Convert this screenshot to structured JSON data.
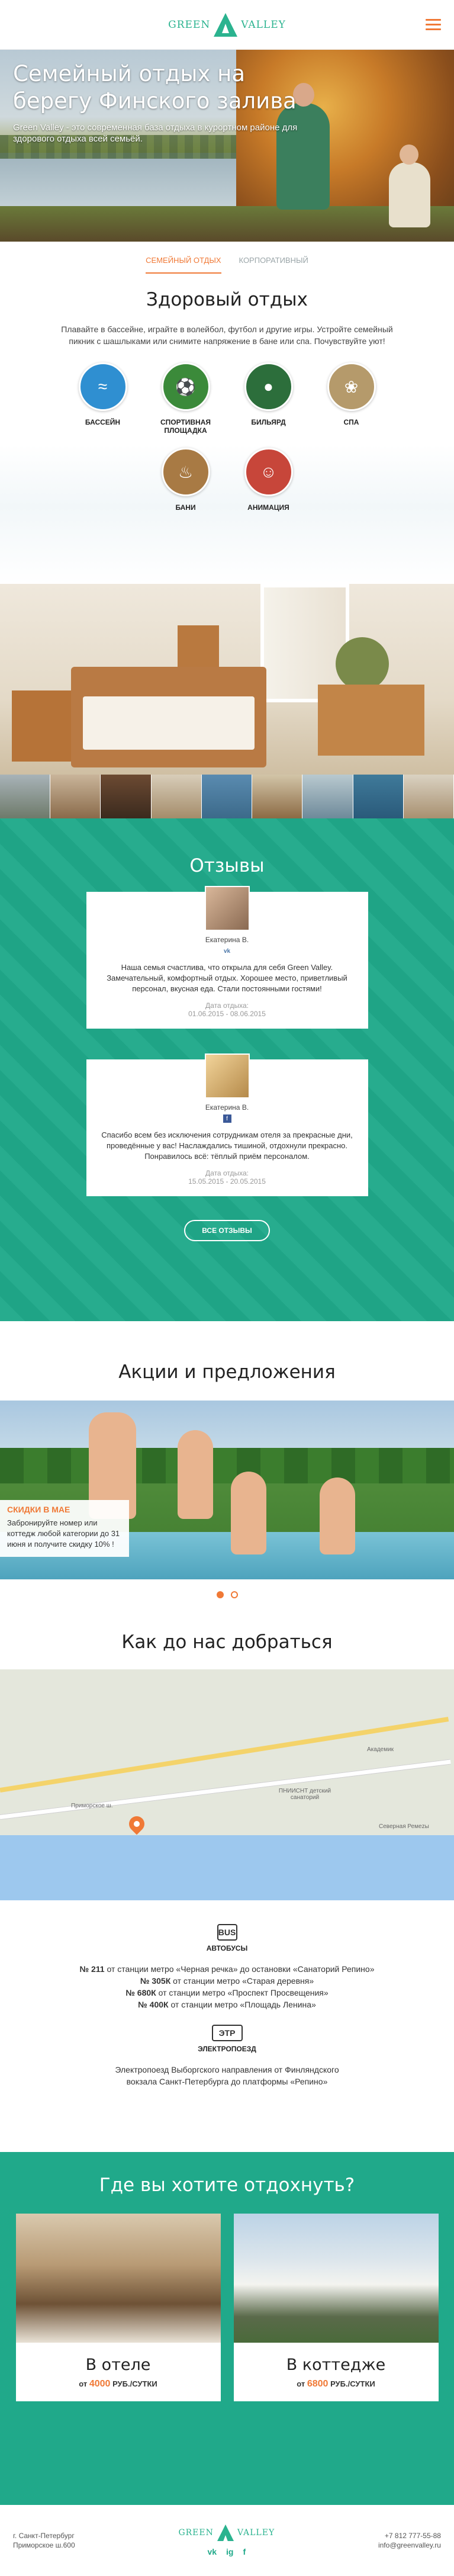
{
  "header": {
    "logo_left": "GREEN",
    "logo_right": "VALLEY"
  },
  "hero": {
    "title": "Семейный отдых на берегу Финского залива",
    "subtitle": "Green Valley - это современная база отдыха в курортном районе для здорового отдыха всей семьёй."
  },
  "tabs": [
    {
      "label": "СЕМЕЙНЫЙ ОТДЫХ"
    },
    {
      "label": "КОРПОРАТИВНЫЙ"
    }
  ],
  "healthy": {
    "title": "Здоровый отдых",
    "text": "Плавайте в бассейне, играйте в волейбол, футбол и другие игры. Устройте семейный пикник с шашлыками или снимите напряжение в бане или спа. Почувствуйте уют!",
    "items": [
      {
        "label": "БАССЕЙН",
        "color": "#2f8fd1"
      },
      {
        "label": "СПОРТИВНАЯ ПЛОЩАДКА",
        "color": "#3b8a3a"
      },
      {
        "label": "БИЛЬЯРД",
        "color": "#2c6e3b"
      },
      {
        "label": "СПА",
        "color": "#b59a6b"
      },
      {
        "label": "БАНИ",
        "color": "#a87a44"
      },
      {
        "label": "АНИМАЦИЯ",
        "color": "#c7463a"
      }
    ]
  },
  "reviews": {
    "title": "Отзывы",
    "items": [
      {
        "name": "Екатерина В.",
        "social": "vk",
        "text": "Наша семья счастлива, что открыла для себя Green Valley. Замечательный, комфортный отдых. Хорошее место, приветливый персонал, вкусная еда. Стали постоянными гостями!",
        "date_label": "Дата отдыха:",
        "date": "01.06.2015 - 08.06.2015"
      },
      {
        "name": "Екатерина В.",
        "social": "f",
        "text": "Спасибо всем без исключения сотрудникам отеля за прекрасные дни, проведённые у вас! Наслаждались тишиной, отдохнули прекрасно. Понравилось всё: тёплый приём персоналом.",
        "date_label": "Дата отдыха:",
        "date": "15.05.2015 - 20.05.2015"
      }
    ],
    "button": "ВСЕ ОТЗЫВЫ"
  },
  "promo": {
    "title": "Акции и предложения",
    "tag": "СКИДКИ В МАЕ",
    "text": "Забронируйте номер или коттедж любой категории до 31 июня и получите скидку 10% !"
  },
  "how": {
    "title": "Как до нас добраться",
    "map_labels": {
      "road": "Приморское ш.",
      "camp": "ПНИИСНТ детский санаторий",
      "akademic": "Академик",
      "north": "Северная Ремеzы"
    }
  },
  "transport": {
    "bus_icon": "BUS",
    "bus_title": "АВТОБУСЫ",
    "bus_lines": [
      {
        "num": "№ 211",
        "text": "от станции метро «Черная речка» до остановки «Санаторий Репино»"
      },
      {
        "num": "№ 305К",
        "text": "от станции метро «Старая деревня»"
      },
      {
        "num": "№ 680К",
        "text": "от станции метро «Проспект Просвещения»"
      },
      {
        "num": "№ 400К",
        "text": "от станции метро «Площадь Ленина»"
      }
    ],
    "train_icon": "ЭТР",
    "train_title": "ЭЛЕКТРОПОЕЗД",
    "train_text": "Электропоезд Выборгского направления от Финляндского вокзала Санкт-Петербурга до платформы «Репино»"
  },
  "where": {
    "title": "Где вы хотите отдохнуть?",
    "cards": [
      {
        "title": "В отеле",
        "price_prefix": "от",
        "price": "4000",
        "price_suffix": "РУБ./СУТКИ"
      },
      {
        "title": "В коттедже",
        "price_prefix": "от",
        "price": "6800",
        "price_suffix": "РУБ./СУТКИ"
      }
    ]
  },
  "footer": {
    "address": [
      "г. Санкт-Петербург",
      "Приморское ш.600"
    ],
    "social": [
      "vk",
      "ig",
      "f"
    ],
    "phone": "+7 812 777-55-88",
    "email": "info@greenvalley.ru"
  },
  "colors": {
    "accent": "#f07936",
    "brand": "#20a98a"
  }
}
